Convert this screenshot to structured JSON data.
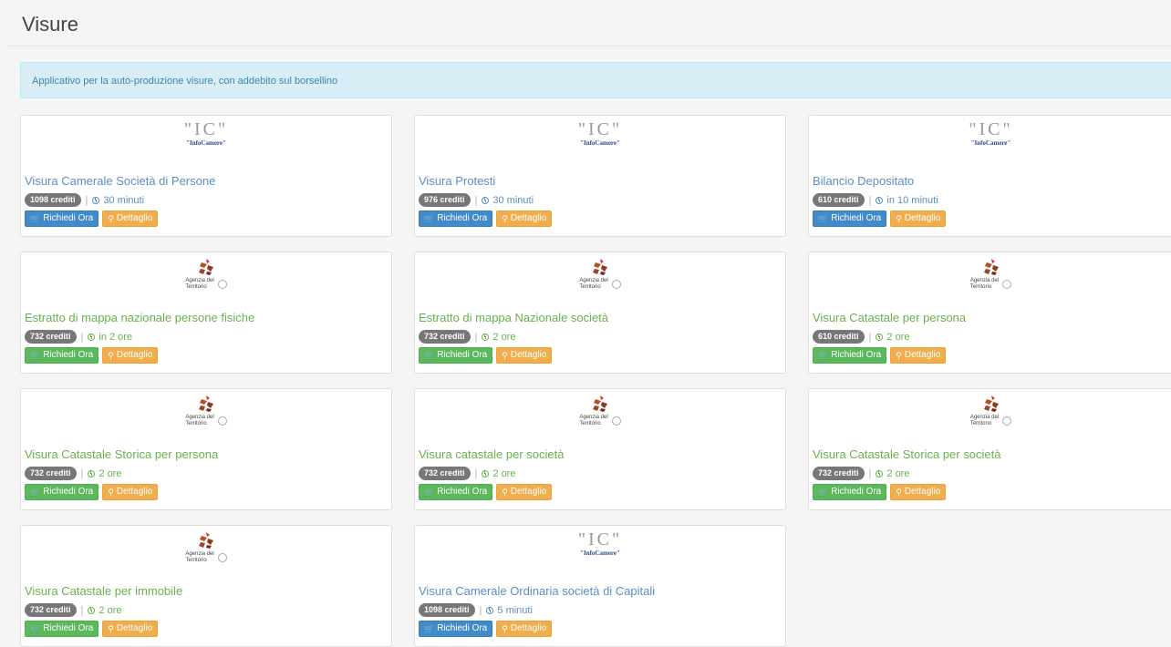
{
  "page": {
    "title": "Visure",
    "info_text": "Applicativo per la auto-produzione visure, con addebito sul borsellino"
  },
  "logos": {
    "infocamere": {
      "mark": "\"IC\"",
      "sub": "\"InfoCamere\""
    },
    "agenzia": {
      "line1": "Agenzia del",
      "line2": "Territorio"
    }
  },
  "buttons": {
    "request": "Richiedi Ora",
    "detail": "Dettaglio"
  },
  "colors": {
    "infocamere_accent": "#428bca",
    "agenzia_accent": "#5cb85c",
    "detail_button": "#f0ad4e",
    "badge": "#777777",
    "agenzia_logo": "#b5502a"
  },
  "cards": [
    {
      "logo": "infocamere",
      "title": "Visura Camerale Società di Persone",
      "credits": "1098 crediti",
      "duration": "30 minuti"
    },
    {
      "logo": "infocamere",
      "title": "Visura Protesti",
      "credits": "976 crediti",
      "duration": "30 minuti"
    },
    {
      "logo": "infocamere",
      "title": "Bilancio Depositato",
      "credits": "610 crediti",
      "duration": "in 10 minuti"
    },
    {
      "logo": "agenzia",
      "title": "Estratto di mappa nazionale persone fisiche",
      "credits": "732 crediti",
      "duration": "in 2 ore"
    },
    {
      "logo": "agenzia",
      "title": "Estratto di mappa Nazionale società",
      "credits": "732 crediti",
      "duration": "2 ore"
    },
    {
      "logo": "agenzia",
      "title": "Visura Catastale per persona",
      "credits": "610 crediti",
      "duration": "2 ore"
    },
    {
      "logo": "agenzia",
      "title": "Visura Catastale Storica per persona",
      "credits": "732 crediti",
      "duration": "2 ore"
    },
    {
      "logo": "agenzia",
      "title": "Visura catastale per società",
      "credits": "732 crediti",
      "duration": "2 ore"
    },
    {
      "logo": "agenzia",
      "title": "Visura Catastale Storica per società",
      "credits": "732 crediti",
      "duration": "2 ore"
    },
    {
      "logo": "agenzia",
      "title": "Visura Catastale per immobile",
      "credits": "732 crediti",
      "duration": "2 ore"
    },
    {
      "logo": "infocamere",
      "title": "Visura Camerale Ordinaria società di Capitali",
      "credits": "1098 crediti",
      "duration": "5 minuti"
    }
  ]
}
